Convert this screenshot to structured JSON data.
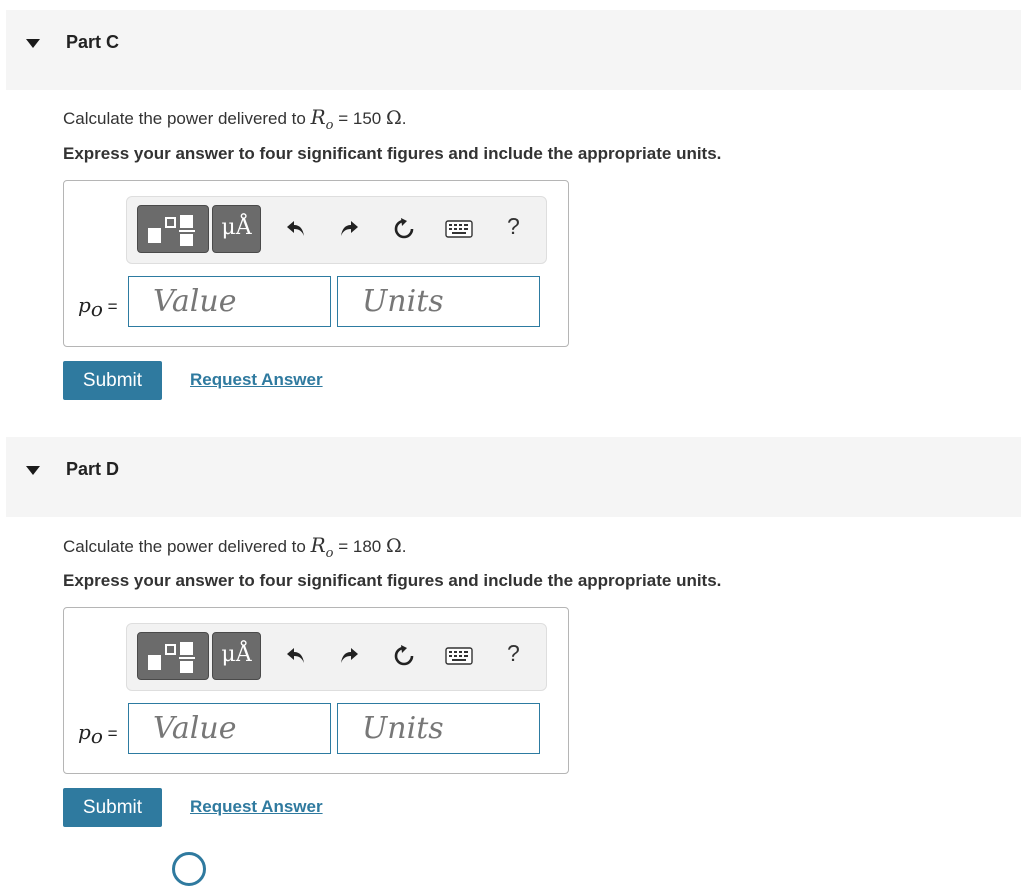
{
  "parts": [
    {
      "title": "Part C",
      "question_prefix": "Calculate the power delivered to ",
      "symbol": "R",
      "subscript": "o",
      "equals": " = 150 ",
      "unit_symbol": "Ω",
      "suffix": ".",
      "instruction": "Express your answer to four significant figures and include the appropriate units.",
      "var_name": "p",
      "var_sub": "o",
      "var_eq": " =",
      "value_placeholder": "Value",
      "units_placeholder": "Units",
      "units_button_label": "μÅ",
      "help_label": "?",
      "submit_label": "Submit",
      "request_label": "Request Answer"
    },
    {
      "title": "Part D",
      "question_prefix": "Calculate the power delivered to ",
      "symbol": "R",
      "subscript": "o",
      "equals": " = 180 ",
      "unit_symbol": "Ω",
      "suffix": ".",
      "instruction": "Express your answer to four significant figures and include the appropriate units.",
      "var_name": "p",
      "var_sub": "o",
      "var_eq": " =",
      "value_placeholder": "Value",
      "units_placeholder": "Units",
      "units_button_label": "μÅ",
      "help_label": "?",
      "submit_label": "Submit",
      "request_label": "Request Answer"
    }
  ],
  "icons": [
    "caret-down-icon",
    "templates-icon",
    "undo-icon",
    "redo-icon",
    "reset-icon",
    "keyboard-icon",
    "help-icon"
  ],
  "colors": {
    "accent": "#2f7a9f",
    "header_bg": "#f5f5f5",
    "toolbar_button": "#6b6b6b"
  }
}
